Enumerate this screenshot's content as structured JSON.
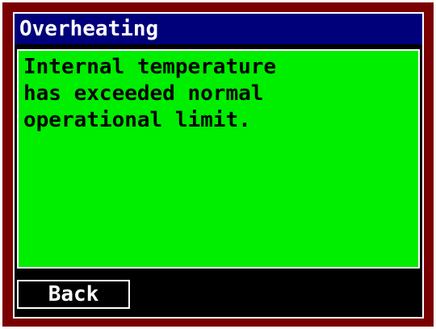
{
  "dialog": {
    "title": "Overheating",
    "message": "Internal temperature\nhas exceeded normal\noperational limit.",
    "back_label": "Back"
  },
  "colors": {
    "frame": "#7a0000",
    "title_bar": "#00007a",
    "message_panel": "#00ee00",
    "screen": "#000000",
    "text_light": "#ffffff",
    "text_dark": "#000000"
  }
}
